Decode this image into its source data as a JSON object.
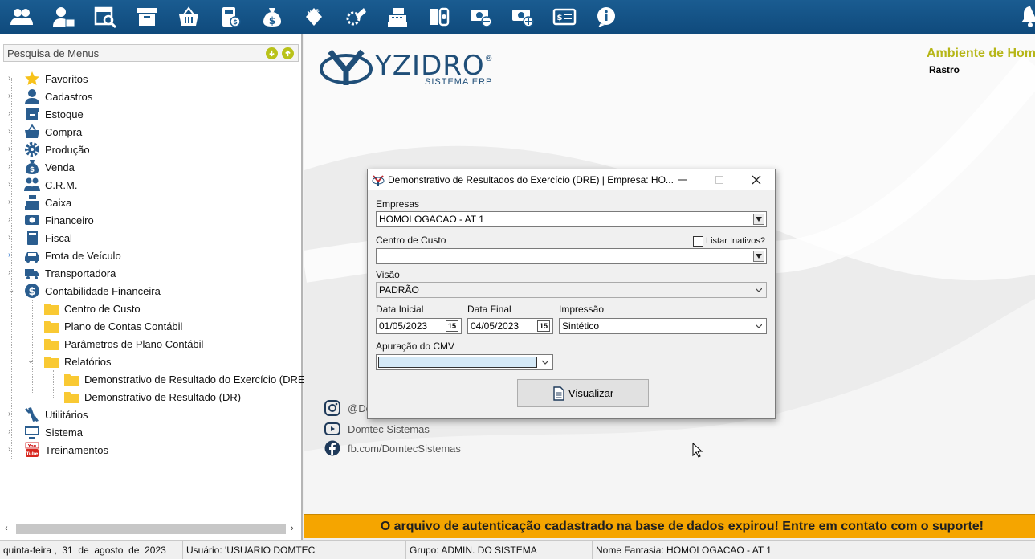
{
  "toolbar": {
    "icons": [
      "users-icon",
      "user-card-icon",
      "search-doc-icon",
      "box-icon",
      "basket-icon",
      "calculator-money-icon",
      "money-bag-icon",
      "nfe-icon",
      "nfse-icon",
      "cash-register-icon",
      "receipt-icon",
      "money-remove-icon",
      "money-add-icon",
      "money-list-icon",
      "info-icon",
      "bell-icon"
    ]
  },
  "sidebar": {
    "search_placeholder": "Pesquisa de Menus",
    "items": [
      {
        "label": "Favoritos",
        "icon": "star-icon"
      },
      {
        "label": "Cadastros",
        "icon": "user-icon"
      },
      {
        "label": "Estoque",
        "icon": "box-icon"
      },
      {
        "label": "Compra",
        "icon": "basket-icon"
      },
      {
        "label": "Produção",
        "icon": "gear-icon"
      },
      {
        "label": "Venda",
        "icon": "money-bag-icon"
      },
      {
        "label": "C.R.M.",
        "icon": "people-icon"
      },
      {
        "label": "Caixa",
        "icon": "cash-register-icon"
      },
      {
        "label": "Financeiro",
        "icon": "money-icon"
      },
      {
        "label": "Fiscal",
        "icon": "book-icon"
      },
      {
        "label": "Frota de Veículo",
        "icon": "car-icon"
      },
      {
        "label": "Transportadora",
        "icon": "truck-icon"
      },
      {
        "label": "Contabilidade Financeira",
        "icon": "dollar-icon"
      },
      {
        "label": "Centro de Custo",
        "icon": "folder-icon"
      },
      {
        "label": "Plano de Contas Contábil",
        "icon": "folder-icon"
      },
      {
        "label": "Parâmetros de Plano Contábil",
        "icon": "folder-icon"
      },
      {
        "label": "Relatórios",
        "icon": "folder-icon"
      },
      {
        "label": "Demonstrativo de Resultado do Exercício (DRE)",
        "icon": "folder-icon"
      },
      {
        "label": "Demonstrativo de Resultado (DR)",
        "icon": "folder-icon"
      },
      {
        "label": "Utilitários",
        "icon": "tools-icon"
      },
      {
        "label": "Sistema",
        "icon": "monitor-icon"
      },
      {
        "label": "Treinamentos",
        "icon": "youtube-icon"
      }
    ]
  },
  "main": {
    "logo_name": "YZIDRO",
    "logo_reg": "®",
    "logo_sub": "SISTEMA ERP",
    "env_title": "Ambiente de Homo",
    "rastro": "Rastro",
    "social": [
      {
        "icon": "instagram-icon",
        "text": "@Do"
      },
      {
        "icon": "youtube-icon",
        "text": "Domtec Sistemas"
      },
      {
        "icon": "facebook-icon",
        "text": "fb.com/DomtecSistemas"
      }
    ]
  },
  "dialog": {
    "title": "Demonstrativo de Resultados do Exercício (DRE) | Empresa: HO...",
    "empresas_label": "Empresas",
    "empresas_value": "HOMOLOGACAO - AT 1",
    "centro_label": "Centro de Custo",
    "listar_inativos": "Listar Inativos?",
    "centro_value": "",
    "visao_label": "Visão",
    "visao_value": "PADRÃO",
    "data_inicial_label": "Data Inicial",
    "data_inicial_value": "01/05/2023",
    "data_final_label": "Data Final",
    "data_final_value": "04/05/2023",
    "calendar_glyph": "15",
    "impressao_label": "Impressão",
    "impressao_value": "Sintético",
    "cmv_label": "Apuração do CMV",
    "cmv_value": "",
    "visualizar_prefix": "V",
    "visualizar_rest": "isualizar"
  },
  "banner": {
    "text": "O arquivo de autenticação cadastrado na base de dados expirou!  Entre em contato com o suporte!"
  },
  "status": {
    "date": "quinta-feira ,  31  de  agosto  de  2023",
    "user": "Usuário: 'USUARIO DOMTEC'",
    "group": "Grupo: ADMIN. DO SISTEMA",
    "fantasia": "Nome Fantasia: HOMOLOGACAO - AT 1"
  }
}
